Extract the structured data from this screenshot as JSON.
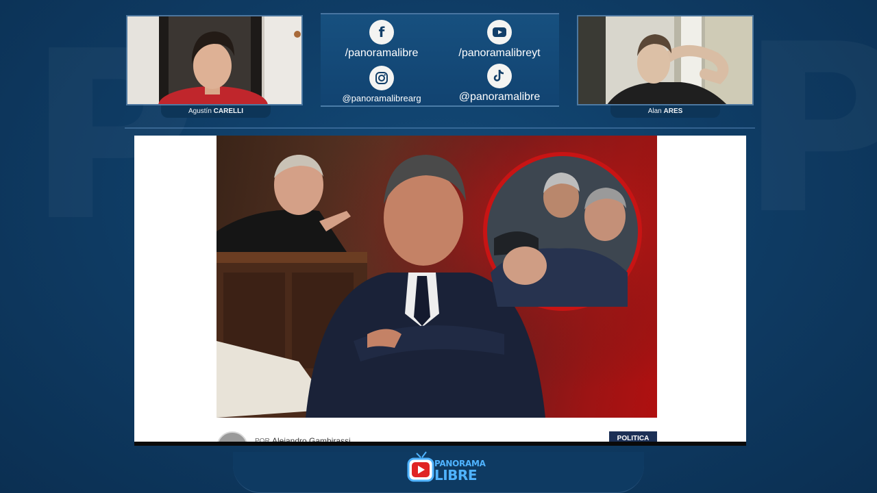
{
  "participants": {
    "left": {
      "first_name": "Agustín",
      "last_name": "CARELLI"
    },
    "right": {
      "first_name": "Alan",
      "last_name": "ARES"
    }
  },
  "socials": [
    {
      "icon": "facebook-icon",
      "handle": "/panoramalibre"
    },
    {
      "icon": "youtube-icon",
      "handle": "/panoramalibreyt"
    },
    {
      "icon": "instagram-icon",
      "handle": "@panoramalibrearg"
    },
    {
      "icon": "tiktok-icon",
      "handle": "@panoramalibre"
    }
  ],
  "article": {
    "byline_prefix": "POR",
    "author": "Alejandro Gambirassi",
    "category": "POLITICA"
  },
  "brand": {
    "name_top": "PANORAMA",
    "name_bottom": "LIBRE"
  },
  "colors": {
    "background": "#0f3d66",
    "panel": "#114371",
    "accent": "#4fb3ff",
    "badge": "#1b2f55",
    "photo_red": "#b01010"
  }
}
